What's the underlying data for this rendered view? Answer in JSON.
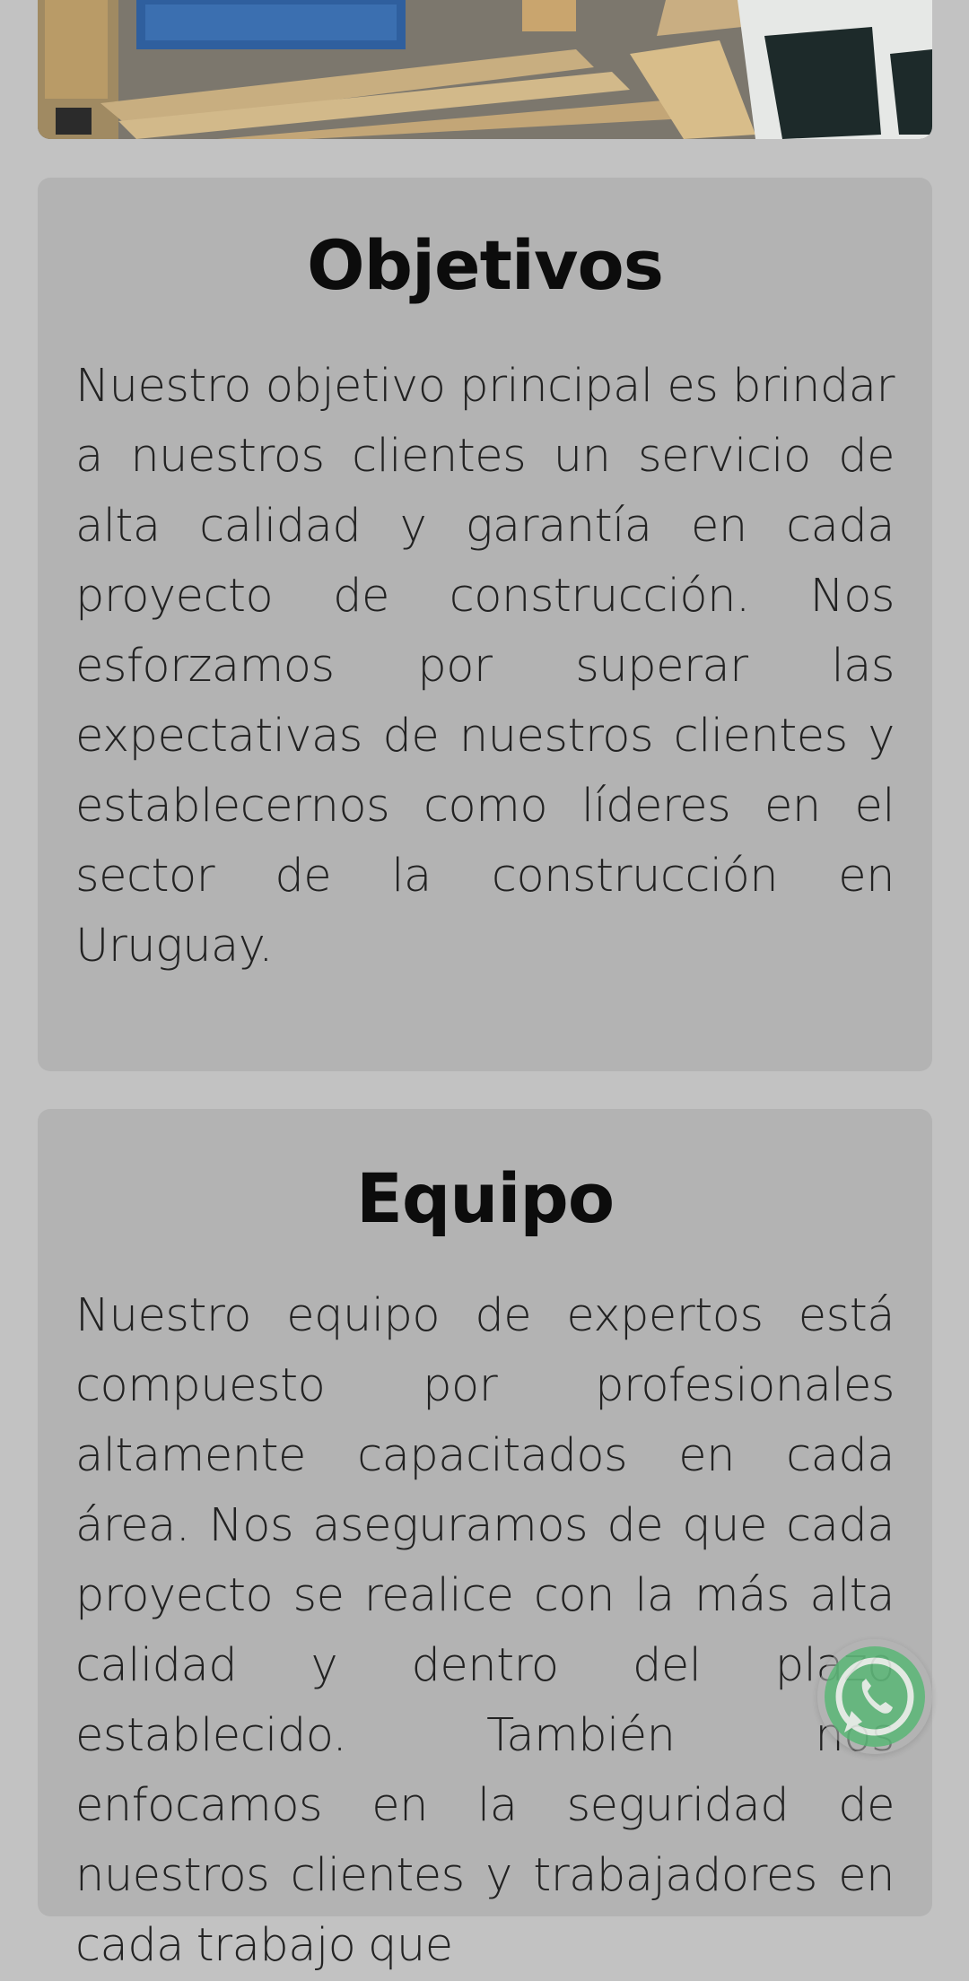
{
  "sections": [
    {
      "title": "Objetivos",
      "body": "Nuestro objetivo principal es brindar a nuestros clientes un servicio de alta calidad y garantía en cada proyecto de construcción. Nos esforzamos por superar las expectativas de nuestros clientes y establecernos como líderes en el sector de la construcción en Uruguay."
    },
    {
      "title": "Equipo",
      "body": "Nuestro equipo de expertos está compuesto por profesionales altamente capacitados en cada área. Nos aseguramos de que cada proyecto se realice con la más alta calidad y dentro del plazo establecido. También nos enfocamos en la seguridad de nuestros clientes y trabajadores en cada trabajo que"
    }
  ],
  "colors": {
    "page_background": "#c2c2c2",
    "card_background": "#b3b3b3",
    "whatsapp_green": "#25d366"
  },
  "icons": {
    "floating_button": "whatsapp-icon"
  }
}
